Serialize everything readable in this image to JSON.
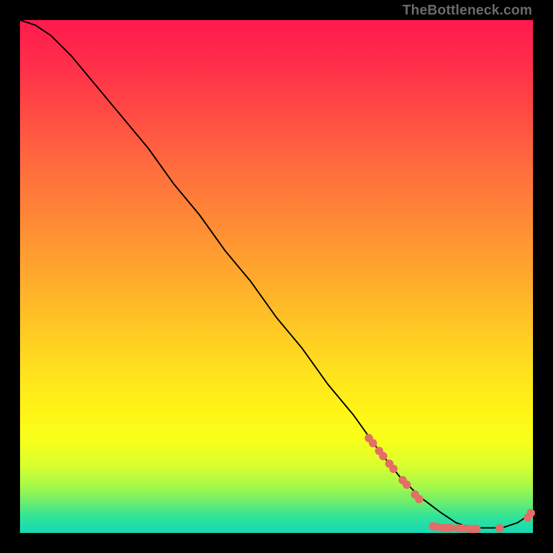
{
  "watermark": "TheBottleneck.com",
  "chart_data": {
    "type": "line",
    "title": "",
    "xlabel": "",
    "ylabel": "",
    "xlim": [
      0,
      100
    ],
    "ylim": [
      0,
      100
    ],
    "grid": false,
    "legend": false,
    "background": "gradient_red_to_green",
    "series": [
      {
        "name": "curve",
        "x": [
          0,
          3,
          6,
          10,
          15,
          20,
          25,
          30,
          35,
          40,
          45,
          50,
          55,
          60,
          65,
          70,
          74,
          78,
          82,
          85,
          88,
          91,
          94,
          97,
          100
        ],
        "y": [
          100,
          99,
          97,
          93,
          87,
          81,
          75,
          68,
          62,
          55,
          49,
          42,
          36,
          29,
          23,
          16,
          11,
          7,
          4,
          2,
          1,
          1,
          1,
          2,
          4
        ]
      }
    ],
    "markers": [
      {
        "x": 68.0,
        "y": 18.5
      },
      {
        "x": 68.8,
        "y": 17.5
      },
      {
        "x": 70.0,
        "y": 16.0
      },
      {
        "x": 70.8,
        "y": 15.0
      },
      {
        "x": 72.0,
        "y": 13.5
      },
      {
        "x": 72.8,
        "y": 12.5
      },
      {
        "x": 74.6,
        "y": 10.3
      },
      {
        "x": 75.4,
        "y": 9.4
      },
      {
        "x": 77.0,
        "y": 7.5
      },
      {
        "x": 77.8,
        "y": 6.6
      },
      {
        "x": 80.5,
        "y": 1.3
      },
      {
        "x": 81.3,
        "y": 1.2
      },
      {
        "x": 82.5,
        "y": 1.0
      },
      {
        "x": 83.3,
        "y": 1.0
      },
      {
        "x": 84.0,
        "y": 1.0
      },
      {
        "x": 85.5,
        "y": 0.9
      },
      {
        "x": 86.3,
        "y": 0.9
      },
      {
        "x": 87.5,
        "y": 0.8
      },
      {
        "x": 88.3,
        "y": 0.8
      },
      {
        "x": 89.0,
        "y": 0.8
      },
      {
        "x": 93.5,
        "y": 0.9
      },
      {
        "x": 99.0,
        "y": 3.0
      },
      {
        "x": 99.6,
        "y": 3.9
      }
    ]
  }
}
